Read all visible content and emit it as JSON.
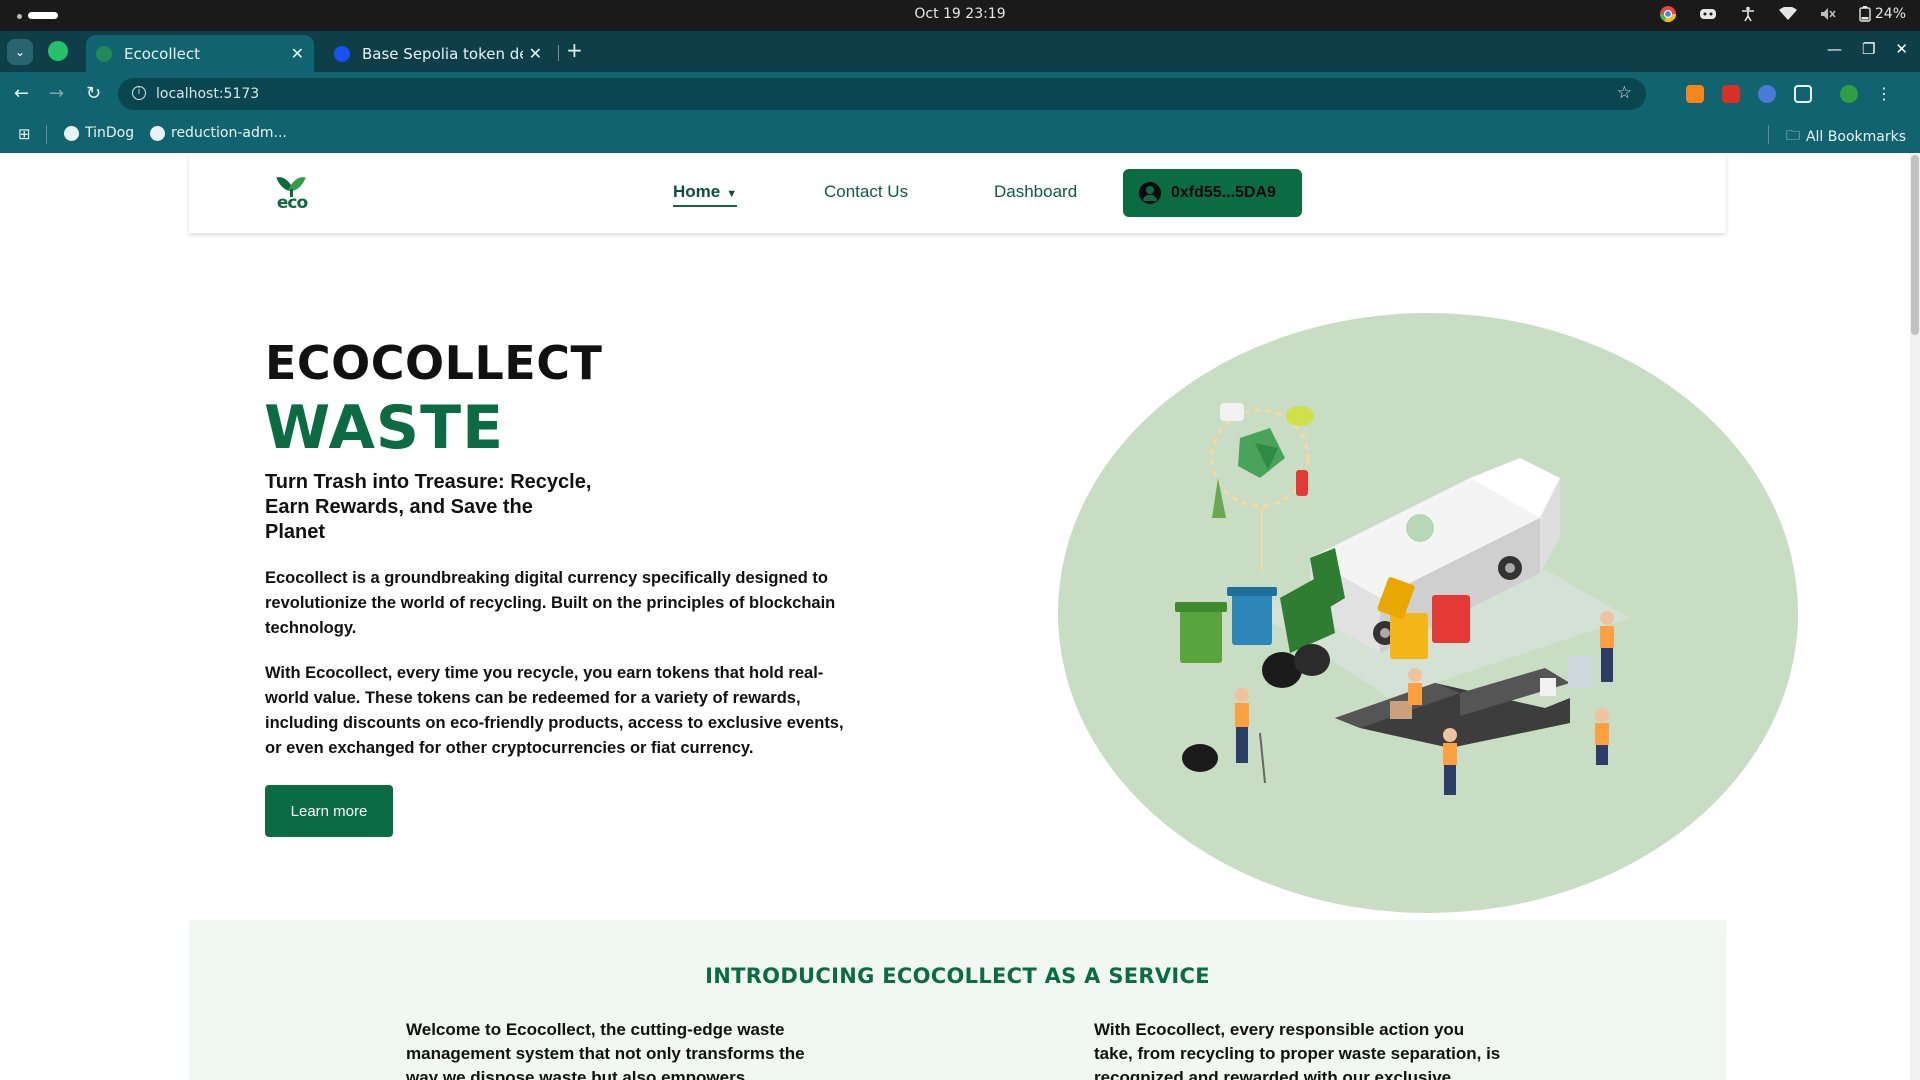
{
  "os": {
    "clock": "Oct 19  23:19",
    "battery": "24%"
  },
  "browser": {
    "tabs": [
      {
        "title": "Ecocollect",
        "active": true
      },
      {
        "title": "Base Sepolia token detai",
        "active": false
      }
    ],
    "url": "localhost:5173",
    "bookmarks": [
      {
        "label": "TinDog"
      },
      {
        "label": "reduction-adm..."
      }
    ],
    "all_bookmarks": "All Bookmarks"
  },
  "site": {
    "logo_text": "eco",
    "nav": {
      "home": "Home",
      "contact": "Contact Us",
      "dashboard": "Dashboard",
      "wallet": "0xfd55...5DA9"
    },
    "hero": {
      "title1": "ECOCOLLECT",
      "title2": "WASTE",
      "subtitle": "Turn Trash into Treasure: Recycle, Earn Rewards, and Save the Planet",
      "p1": "Ecocollect is a groundbreaking digital currency specifically designed to revolutionize the world of recycling. Built on the principles of blockchain technology.",
      "p2": "With Ecocollect, every time you recycle, you earn tokens that hold real-world value. These tokens can be redeemed for a variety of rewards, including discounts on eco-friendly products, access to exclusive events, or even exchanged for other cryptocurrencies or fiat currency.",
      "cta": "Learn more"
    },
    "service": {
      "title": "INTRODUCING ECOCOLLECT AS A SERVICE",
      "col1": "Welcome to Ecocollect, the cutting-edge waste management system that not only transforms the way we dispose waste but also empowers",
      "col2": "With Ecocollect, every responsible action you take, from recycling to proper waste separation, is recognized and rewarded with our exclusive"
    }
  },
  "colors": {
    "brand_green": "#0b6b43",
    "blob_green": "#c9dcc4",
    "browser_teal": "#10636f"
  }
}
